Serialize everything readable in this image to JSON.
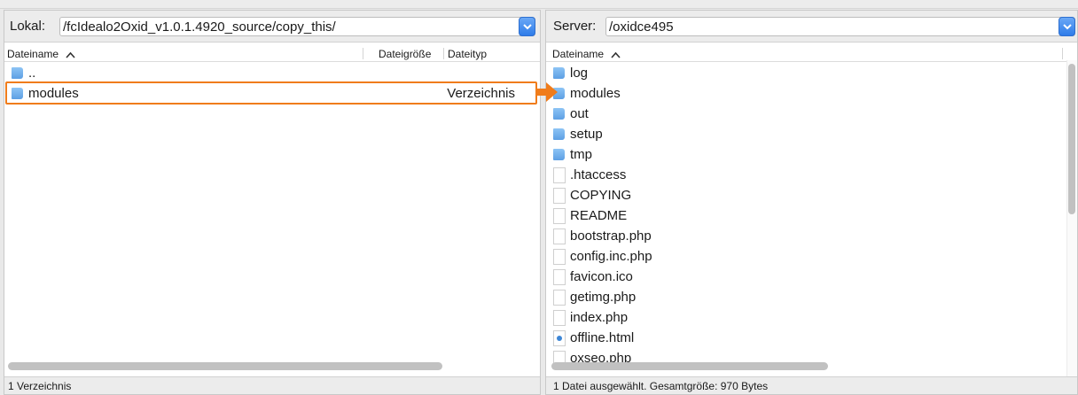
{
  "local": {
    "label": "Lokal:",
    "path": "/fcIdealo2Oxid_v1.0.1.4920_source/copy_this/",
    "columns": {
      "name": "Dateiname",
      "size": "Dateigröße",
      "type": "Dateityp"
    },
    "items": [
      {
        "name": "..",
        "kind": "folder",
        "type": ""
      },
      {
        "name": "modules",
        "kind": "folder",
        "type": "Verzeichnis"
      }
    ],
    "status": "1 Verzeichnis"
  },
  "server": {
    "label": "Server:",
    "path": "/oxidce495",
    "columns": {
      "name": "Dateiname"
    },
    "items": [
      {
        "name": "log",
        "kind": "folder"
      },
      {
        "name": "modules",
        "kind": "folder"
      },
      {
        "name": "out",
        "kind": "folder"
      },
      {
        "name": "setup",
        "kind": "folder"
      },
      {
        "name": "tmp",
        "kind": "folder"
      },
      {
        "name": ".htaccess",
        "kind": "file"
      },
      {
        "name": "COPYING",
        "kind": "file"
      },
      {
        "name": "README",
        "kind": "file"
      },
      {
        "name": "bootstrap.php",
        "kind": "file"
      },
      {
        "name": "config.inc.php",
        "kind": "file"
      },
      {
        "name": "favicon.ico",
        "kind": "file"
      },
      {
        "name": "getimg.php",
        "kind": "file"
      },
      {
        "name": "index.php",
        "kind": "file"
      },
      {
        "name": "offline.html",
        "kind": "html"
      },
      {
        "name": "oxseo.php",
        "kind": "file"
      }
    ],
    "status": "1 Datei ausgewählt. Gesamtgröße: 970 Bytes"
  },
  "colors": {
    "highlight": "#f07c1b",
    "folder": "#6aa9ec",
    "combo_button": "#3a86ee"
  },
  "icons": [
    "folder-icon",
    "file-icon",
    "html-file-icon",
    "sort-ascending-icon",
    "combo-chevron-icon",
    "arrow-right-icon"
  ]
}
